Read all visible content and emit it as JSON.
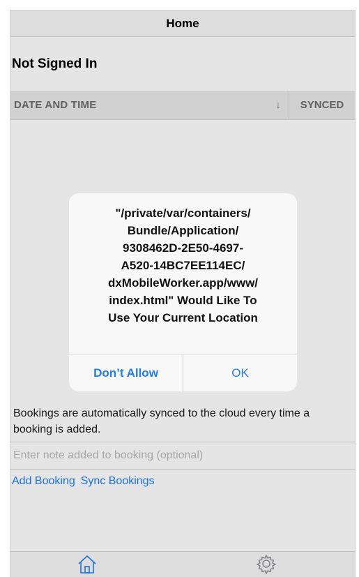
{
  "navbar": {
    "title": "Home"
  },
  "page": {
    "heading": "Not Signed In"
  },
  "table": {
    "col_date": "DATE AND TIME",
    "sort_indicator": "↓",
    "col_synced": "SYNCED"
  },
  "info": {
    "text": "Bookings are automatically synced to the cloud every time a booking is added."
  },
  "note": {
    "placeholder": "Enter note added to booking (optional)"
  },
  "actions": {
    "add_booking": "Add Booking",
    "sync_bookings": "Sync Bookings"
  },
  "tabbar": {
    "items": [
      {
        "icon": "home-icon"
      },
      {
        "icon": "gear-icon"
      }
    ]
  },
  "alert": {
    "message": "\"/private/var/containers/\nBundle/Application/\n9308462D-2E50-4697-\nA520-14BC7EE114EC/\ndxMobileWorker.app/www/\nindex.html\" Would Like To\nUse Your Current Location",
    "deny_label": "Don’t Allow",
    "ok_label": "OK"
  },
  "colors": {
    "accent": "#1f7cf5",
    "header_bg": "#e9e9e9",
    "bar_bg": "#f7f7f7"
  }
}
